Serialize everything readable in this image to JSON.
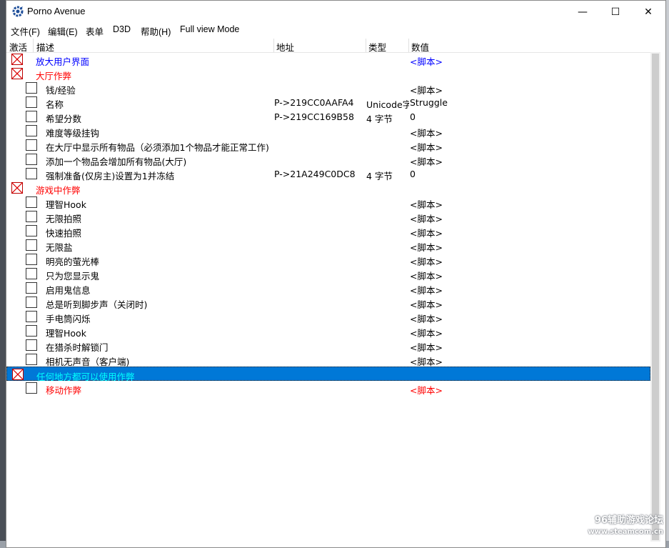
{
  "window": {
    "title": "Porno Avenue",
    "icon": "cheat-engine-gear-icon",
    "minimize_glyph": "—",
    "maximize_glyph": "☐",
    "close_glyph": "✕"
  },
  "menu": [
    {
      "label": "文件(F)"
    },
    {
      "label": "编辑(E)"
    },
    {
      "label": "表单"
    },
    {
      "label": "D3D"
    },
    {
      "label": "帮助(H)"
    },
    {
      "label": "Full view Mode"
    }
  ],
  "columns": {
    "active": "激活",
    "description": "描述",
    "address": "地址",
    "type": "类型",
    "value": "数值"
  },
  "colors": {
    "blue_text": "#0000ff",
    "red_text": "#ff0000",
    "selection": "#0078d7",
    "selected_text": "#00ffff"
  },
  "rows": [
    {
      "desc": "放大用户界面",
      "addr": "",
      "type": "",
      "value": "<脚本>",
      "checked": true,
      "indent": 0,
      "color": "blue"
    },
    {
      "desc": "大厅作弊",
      "addr": "",
      "type": "",
      "value": "",
      "checked": true,
      "indent": 0,
      "color": "red"
    },
    {
      "desc": "钱/经验",
      "addr": "",
      "type": "",
      "value": "<脚本>",
      "checked": false,
      "indent": 1,
      "color": "black"
    },
    {
      "desc": "名称",
      "addr": "P->219CC0AAFA4",
      "type": "Unicode字",
      "value": "Struggle",
      "checked": false,
      "indent": 1,
      "color": "black"
    },
    {
      "desc": "希望分数",
      "addr": "P->219CC169B58",
      "type": "4 字节",
      "value": "0",
      "checked": false,
      "indent": 1,
      "color": "black"
    },
    {
      "desc": "难度等级挂钩",
      "addr": "",
      "type": "",
      "value": "<脚本>",
      "checked": false,
      "indent": 1,
      "color": "black"
    },
    {
      "desc": "在大厅中显示所有物品（必须添加1个物品才能正常工作)",
      "addr": "",
      "type": "",
      "value": "<脚本>",
      "checked": false,
      "indent": 1,
      "color": "black"
    },
    {
      "desc": "添加一个物品会增加所有物品(大厅)",
      "addr": "",
      "type": "",
      "value": "<脚本>",
      "checked": false,
      "indent": 1,
      "color": "black"
    },
    {
      "desc": "强制准备(仅房主)设置为1并冻结",
      "addr": "P->21A249C0DC8",
      "type": "4 字节",
      "value": "0",
      "checked": false,
      "indent": 1,
      "color": "black"
    },
    {
      "desc": "游戏中作弊",
      "addr": "",
      "type": "",
      "value": "",
      "checked": true,
      "indent": 0,
      "color": "red"
    },
    {
      "desc": "理智Hook",
      "addr": "",
      "type": "",
      "value": "<脚本>",
      "checked": false,
      "indent": 1,
      "color": "black"
    },
    {
      "desc": "无限拍照",
      "addr": "",
      "type": "",
      "value": "<脚本>",
      "checked": false,
      "indent": 1,
      "color": "black"
    },
    {
      "desc": "快速拍照",
      "addr": "",
      "type": "",
      "value": "<脚本>",
      "checked": false,
      "indent": 1,
      "color": "black"
    },
    {
      "desc": "无限盐",
      "addr": "",
      "type": "",
      "value": "<脚本>",
      "checked": false,
      "indent": 1,
      "color": "black"
    },
    {
      "desc": "明亮的萤光棒",
      "addr": "",
      "type": "",
      "value": "<脚本>",
      "checked": false,
      "indent": 1,
      "color": "black"
    },
    {
      "desc": "只为您显示鬼",
      "addr": "",
      "type": "",
      "value": "<脚本>",
      "checked": false,
      "indent": 1,
      "color": "black"
    },
    {
      "desc": "启用鬼信息",
      "addr": "",
      "type": "",
      "value": "<脚本>",
      "checked": false,
      "indent": 1,
      "color": "black"
    },
    {
      "desc": "总是听到脚步声（关闭时)",
      "addr": "",
      "type": "",
      "value": "<脚本>",
      "checked": false,
      "indent": 1,
      "color": "black"
    },
    {
      "desc": "手电筒闪烁",
      "addr": "",
      "type": "",
      "value": "<脚本>",
      "checked": false,
      "indent": 1,
      "color": "black"
    },
    {
      "desc": "理智Hook",
      "addr": "",
      "type": "",
      "value": "<脚本>",
      "checked": false,
      "indent": 1,
      "color": "black"
    },
    {
      "desc": "在猎杀时解锁门",
      "addr": "",
      "type": "",
      "value": "<脚本>",
      "checked": false,
      "indent": 1,
      "color": "black"
    },
    {
      "desc": "相机无声音（客户端)",
      "addr": "",
      "type": "",
      "value": "<脚本>",
      "checked": false,
      "indent": 1,
      "color": "black"
    },
    {
      "desc": "任何地方都可以使用作弊",
      "addr": "",
      "type": "",
      "value": "",
      "checked": true,
      "indent": 0,
      "color": "cyan",
      "selected": true
    },
    {
      "desc": "移动作弊",
      "addr": "",
      "type": "",
      "value": "<脚本>",
      "checked": false,
      "indent": 1,
      "color": "red"
    }
  ],
  "watermark": {
    "line1": "96辅助游戏论坛",
    "line2": "www.steamcom.cn"
  }
}
